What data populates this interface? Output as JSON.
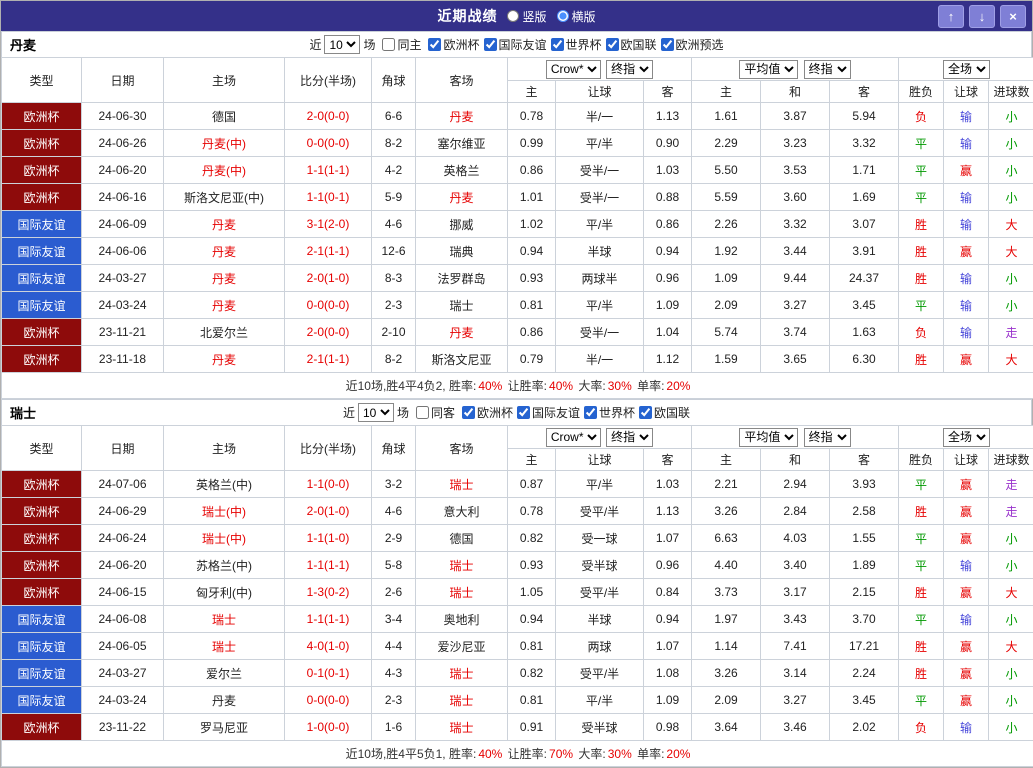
{
  "titlebar": {
    "title": "近期战绩",
    "radio_vertical": "竖版",
    "radio_horizontal": "横版",
    "selected": "横版",
    "up_icon": "↑",
    "down_icon": "↓",
    "close_icon": "×"
  },
  "labels": {
    "near": "近",
    "games": "场"
  },
  "columns": {
    "type": "类型",
    "date": "日期",
    "home": "主场",
    "score": "比分(半场)",
    "corner": "角球",
    "away": "客场",
    "book": "Crow*",
    "final": "终指",
    "avg": "平均值",
    "final2": "终指",
    "full": "全场",
    "sub": [
      "主",
      "让球",
      "客",
      "主",
      "和",
      "客",
      "胜负",
      "让球",
      "进球数"
    ]
  },
  "colors": {
    "titlebar_bg": "#343089",
    "euro_bg": "#8e0b0b",
    "friendly_bg": "#2b5cd0",
    "win_red": "#e60000",
    "draw_green": "#009900",
    "lose_blue": "#4444d9",
    "push_purple": "#9932cc"
  },
  "sections": [
    {
      "team": "丹麦",
      "filter": {
        "count": "10",
        "same_label": "同主",
        "same_checked": false,
        "leagues": [
          {
            "label": "欧洲杯",
            "checked": true
          },
          {
            "label": "国际友谊",
            "checked": true
          },
          {
            "label": "世界杯",
            "checked": true
          },
          {
            "label": "欧国联",
            "checked": true
          },
          {
            "label": "欧洲预选",
            "checked": true
          }
        ]
      },
      "rows": [
        {
          "type": "欧洲杯",
          "type_cls": "euro",
          "date": "24-06-30",
          "home": "德国",
          "home_red": false,
          "score": "2-0(0-0)",
          "corner": "6-6",
          "away": "丹麦",
          "away_red": true,
          "odds": [
            "0.78",
            "半/一",
            "1.13",
            "1.61",
            "3.87",
            "5.94"
          ],
          "results": [
            {
              "t": "负",
              "c": "red"
            },
            {
              "t": "输",
              "c": "blue"
            },
            {
              "t": "小",
              "c": "green"
            }
          ]
        },
        {
          "type": "欧洲杯",
          "type_cls": "euro",
          "date": "24-06-26",
          "home": "丹麦(中)",
          "home_red": true,
          "score": "0-0(0-0)",
          "corner": "8-2",
          "away": "塞尔维亚",
          "away_red": false,
          "odds": [
            "0.99",
            "平/半",
            "0.90",
            "2.29",
            "3.23",
            "3.32"
          ],
          "results": [
            {
              "t": "平",
              "c": "green"
            },
            {
              "t": "输",
              "c": "blue"
            },
            {
              "t": "小",
              "c": "green"
            }
          ]
        },
        {
          "type": "欧洲杯",
          "type_cls": "euro",
          "date": "24-06-20",
          "home": "丹麦(中)",
          "home_red": true,
          "score": "1-1(1-1)",
          "corner": "4-2",
          "away": "英格兰",
          "away_red": false,
          "odds": [
            "0.86",
            "受半/一",
            "1.03",
            "5.50",
            "3.53",
            "1.71"
          ],
          "results": [
            {
              "t": "平",
              "c": "green"
            },
            {
              "t": "赢",
              "c": "red"
            },
            {
              "t": "小",
              "c": "green"
            }
          ]
        },
        {
          "type": "欧洲杯",
          "type_cls": "euro",
          "date": "24-06-16",
          "home": "斯洛文尼亚(中)",
          "home_red": false,
          "score": "1-1(0-1)",
          "corner": "5-9",
          "away": "丹麦",
          "away_red": true,
          "odds": [
            "1.01",
            "受半/一",
            "0.88",
            "5.59",
            "3.60",
            "1.69"
          ],
          "results": [
            {
              "t": "平",
              "c": "green"
            },
            {
              "t": "输",
              "c": "blue"
            },
            {
              "t": "小",
              "c": "green"
            }
          ]
        },
        {
          "type": "国际友谊",
          "type_cls": "frd",
          "date": "24-06-09",
          "home": "丹麦",
          "home_red": true,
          "score": "3-1(2-0)",
          "corner": "4-6",
          "away": "挪威",
          "away_red": false,
          "odds": [
            "1.02",
            "平/半",
            "0.86",
            "2.26",
            "3.32",
            "3.07"
          ],
          "results": [
            {
              "t": "胜",
              "c": "red"
            },
            {
              "t": "输",
              "c": "blue"
            },
            {
              "t": "大",
              "c": "red"
            }
          ]
        },
        {
          "type": "国际友谊",
          "type_cls": "frd",
          "date": "24-06-06",
          "home": "丹麦",
          "home_red": true,
          "score": "2-1(1-1)",
          "corner": "12-6",
          "away": "瑞典",
          "away_red": false,
          "odds": [
            "0.94",
            "半球",
            "0.94",
            "1.92",
            "3.44",
            "3.91"
          ],
          "results": [
            {
              "t": "胜",
              "c": "red"
            },
            {
              "t": "赢",
              "c": "red"
            },
            {
              "t": "大",
              "c": "red"
            }
          ]
        },
        {
          "type": "国际友谊",
          "type_cls": "frd",
          "date": "24-03-27",
          "home": "丹麦",
          "home_red": true,
          "score": "2-0(1-0)",
          "corner": "8-3",
          "away": "法罗群岛",
          "away_red": false,
          "odds": [
            "0.93",
            "两球半",
            "0.96",
            "1.09",
            "9.44",
            "24.37"
          ],
          "results": [
            {
              "t": "胜",
              "c": "red"
            },
            {
              "t": "输",
              "c": "blue"
            },
            {
              "t": "小",
              "c": "green"
            }
          ]
        },
        {
          "type": "国际友谊",
          "type_cls": "frd",
          "date": "24-03-24",
          "home": "丹麦",
          "home_red": true,
          "score": "0-0(0-0)",
          "corner": "2-3",
          "away": "瑞士",
          "away_red": false,
          "odds": [
            "0.81",
            "平/半",
            "1.09",
            "2.09",
            "3.27",
            "3.45"
          ],
          "results": [
            {
              "t": "平",
              "c": "green"
            },
            {
              "t": "输",
              "c": "blue"
            },
            {
              "t": "小",
              "c": "green"
            }
          ]
        },
        {
          "type": "欧洲杯",
          "type_cls": "euro",
          "date": "23-11-21",
          "home": "北爱尔兰",
          "home_red": false,
          "score": "2-0(0-0)",
          "corner": "2-10",
          "away": "丹麦",
          "away_red": true,
          "odds": [
            "0.86",
            "受半/一",
            "1.04",
            "5.74",
            "3.74",
            "1.63"
          ],
          "results": [
            {
              "t": "负",
              "c": "red"
            },
            {
              "t": "输",
              "c": "blue"
            },
            {
              "t": "走",
              "c": "purple"
            }
          ]
        },
        {
          "type": "欧洲杯",
          "type_cls": "euro",
          "date": "23-11-18",
          "home": "丹麦",
          "home_red": true,
          "score": "2-1(1-1)",
          "corner": "8-2",
          "away": "斯洛文尼亚",
          "away_red": false,
          "odds": [
            "0.79",
            "半/一",
            "1.12",
            "1.59",
            "3.65",
            "6.30"
          ],
          "results": [
            {
              "t": "胜",
              "c": "red"
            },
            {
              "t": "赢",
              "c": "red"
            },
            {
              "t": "大",
              "c": "red"
            }
          ]
        }
      ],
      "summary": [
        {
          "t": "近10场,胜4平4负2, 胜率:",
          "c": "dark"
        },
        {
          "t": "40%",
          "c": "red"
        },
        {
          "t": " 让胜率:",
          "c": "dark"
        },
        {
          "t": "40%",
          "c": "red"
        },
        {
          "t": " 大率:",
          "c": "dark"
        },
        {
          "t": "30%",
          "c": "red"
        },
        {
          "t": " 单率:",
          "c": "dark"
        },
        {
          "t": "20%",
          "c": "red"
        }
      ]
    },
    {
      "team": "瑞士",
      "filter": {
        "count": "10",
        "same_label": "同客",
        "same_checked": false,
        "leagues": [
          {
            "label": "欧洲杯",
            "checked": true
          },
          {
            "label": "国际友谊",
            "checked": true
          },
          {
            "label": "世界杯",
            "checked": true
          },
          {
            "label": "欧国联",
            "checked": true
          }
        ]
      },
      "rows": [
        {
          "type": "欧洲杯",
          "type_cls": "euro",
          "date": "24-07-06",
          "home": "英格兰(中)",
          "home_red": false,
          "score": "1-1(0-0)",
          "corner": "3-2",
          "away": "瑞士",
          "away_red": true,
          "odds": [
            "0.87",
            "平/半",
            "1.03",
            "2.21",
            "2.94",
            "3.93"
          ],
          "results": [
            {
              "t": "平",
              "c": "green"
            },
            {
              "t": "赢",
              "c": "red"
            },
            {
              "t": "走",
              "c": "purple"
            }
          ]
        },
        {
          "type": "欧洲杯",
          "type_cls": "euro",
          "date": "24-06-29",
          "home": "瑞士(中)",
          "home_red": true,
          "score": "2-0(1-0)",
          "corner": "4-6",
          "away": "意大利",
          "away_red": false,
          "odds": [
            "0.78",
            "受平/半",
            "1.13",
            "3.26",
            "2.84",
            "2.58"
          ],
          "results": [
            {
              "t": "胜",
              "c": "red"
            },
            {
              "t": "赢",
              "c": "red"
            },
            {
              "t": "走",
              "c": "purple"
            }
          ]
        },
        {
          "type": "欧洲杯",
          "type_cls": "euro",
          "date": "24-06-24",
          "home": "瑞士(中)",
          "home_red": true,
          "score": "1-1(1-0)",
          "corner": "2-9",
          "away": "德国",
          "away_red": false,
          "odds": [
            "0.82",
            "受一球",
            "1.07",
            "6.63",
            "4.03",
            "1.55"
          ],
          "results": [
            {
              "t": "平",
              "c": "green"
            },
            {
              "t": "赢",
              "c": "red"
            },
            {
              "t": "小",
              "c": "green"
            }
          ]
        },
        {
          "type": "欧洲杯",
          "type_cls": "euro",
          "date": "24-06-20",
          "home": "苏格兰(中)",
          "home_red": false,
          "score": "1-1(1-1)",
          "corner": "5-8",
          "away": "瑞士",
          "away_red": true,
          "odds": [
            "0.93",
            "受半球",
            "0.96",
            "4.40",
            "3.40",
            "1.89"
          ],
          "results": [
            {
              "t": "平",
              "c": "green"
            },
            {
              "t": "输",
              "c": "blue"
            },
            {
              "t": "小",
              "c": "green"
            }
          ]
        },
        {
          "type": "欧洲杯",
          "type_cls": "euro",
          "date": "24-06-15",
          "home": "匈牙利(中)",
          "home_red": false,
          "score": "1-3(0-2)",
          "corner": "2-6",
          "away": "瑞士",
          "away_red": true,
          "odds": [
            "1.05",
            "受平/半",
            "0.84",
            "3.73",
            "3.17",
            "2.15"
          ],
          "results": [
            {
              "t": "胜",
              "c": "red"
            },
            {
              "t": "赢",
              "c": "red"
            },
            {
              "t": "大",
              "c": "red"
            }
          ]
        },
        {
          "type": "国际友谊",
          "type_cls": "frd",
          "date": "24-06-08",
          "home": "瑞士",
          "home_red": true,
          "score": "1-1(1-1)",
          "corner": "3-4",
          "away": "奥地利",
          "away_red": false,
          "odds": [
            "0.94",
            "半球",
            "0.94",
            "1.97",
            "3.43",
            "3.70"
          ],
          "results": [
            {
              "t": "平",
              "c": "green"
            },
            {
              "t": "输",
              "c": "blue"
            },
            {
              "t": "小",
              "c": "green"
            }
          ]
        },
        {
          "type": "国际友谊",
          "type_cls": "frd",
          "date": "24-06-05",
          "home": "瑞士",
          "home_red": true,
          "score": "4-0(1-0)",
          "corner": "4-4",
          "away": "爱沙尼亚",
          "away_red": false,
          "odds": [
            "0.81",
            "两球",
            "1.07",
            "1.14",
            "7.41",
            "17.21"
          ],
          "results": [
            {
              "t": "胜",
              "c": "red"
            },
            {
              "t": "赢",
              "c": "red"
            },
            {
              "t": "大",
              "c": "red"
            }
          ]
        },
        {
          "type": "国际友谊",
          "type_cls": "frd",
          "date": "24-03-27",
          "home": "爱尔兰",
          "home_red": false,
          "score": "0-1(0-1)",
          "corner": "4-3",
          "away": "瑞士",
          "away_red": true,
          "odds": [
            "0.82",
            "受平/半",
            "1.08",
            "3.26",
            "3.14",
            "2.24"
          ],
          "results": [
            {
              "t": "胜",
              "c": "red"
            },
            {
              "t": "赢",
              "c": "red"
            },
            {
              "t": "小",
              "c": "green"
            }
          ]
        },
        {
          "type": "国际友谊",
          "type_cls": "frd",
          "date": "24-03-24",
          "home": "丹麦",
          "home_red": false,
          "score": "0-0(0-0)",
          "corner": "2-3",
          "away": "瑞士",
          "away_red": true,
          "odds": [
            "0.81",
            "平/半",
            "1.09",
            "2.09",
            "3.27",
            "3.45"
          ],
          "results": [
            {
              "t": "平",
              "c": "green"
            },
            {
              "t": "赢",
              "c": "red"
            },
            {
              "t": "小",
              "c": "green"
            }
          ]
        },
        {
          "type": "欧洲杯",
          "type_cls": "euro",
          "date": "23-11-22",
          "home": "罗马尼亚",
          "home_red": false,
          "score": "1-0(0-0)",
          "corner": "1-6",
          "away": "瑞士",
          "away_red": true,
          "odds": [
            "0.91",
            "受半球",
            "0.98",
            "3.64",
            "3.46",
            "2.02"
          ],
          "results": [
            {
              "t": "负",
              "c": "red"
            },
            {
              "t": "输",
              "c": "blue"
            },
            {
              "t": "小",
              "c": "green"
            }
          ]
        }
      ],
      "summary": [
        {
          "t": "近10场,胜4平5负1, 胜率:",
          "c": "dark"
        },
        {
          "t": "40%",
          "c": "red"
        },
        {
          "t": " 让胜率:",
          "c": "dark"
        },
        {
          "t": "70%",
          "c": "red"
        },
        {
          "t": " 大率:",
          "c": "dark"
        },
        {
          "t": "30%",
          "c": "red"
        },
        {
          "t": " 单率:",
          "c": "dark"
        },
        {
          "t": "20%",
          "c": "red"
        }
      ]
    }
  ]
}
